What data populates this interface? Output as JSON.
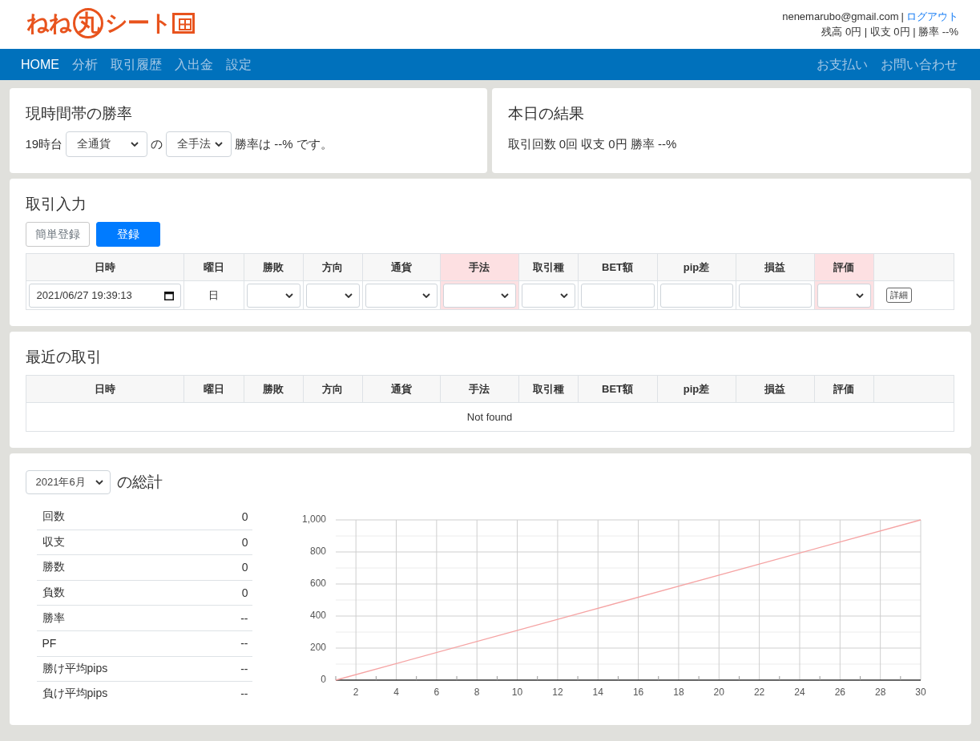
{
  "header": {
    "logo": [
      {
        "text": "ねね",
        "circled": false
      },
      {
        "text": "丸",
        "circled": true
      },
      {
        "text": "シート",
        "circled": false
      }
    ],
    "email": "nenemarubo@gmail.com",
    "separator": "|",
    "logout": "ログアウト",
    "summary": "残高 0円 | 収支 0円 | 勝率 --%"
  },
  "nav": {
    "left": [
      {
        "label": "HOME",
        "selected": true
      },
      {
        "label": "分析",
        "selected": false
      },
      {
        "label": "取引履歴",
        "selected": false
      },
      {
        "label": "入出金",
        "selected": false
      },
      {
        "label": "設定",
        "selected": false
      }
    ],
    "right": [
      {
        "label": "お支払い",
        "selected": false
      },
      {
        "label": "お問い合わせ",
        "selected": false
      }
    ]
  },
  "hour_win_rate": {
    "title": "現時間帯の勝率",
    "hour": "19時台",
    "currency": "全通貨",
    "particle": "の",
    "method": "全手法",
    "result": "勝率は --% です。"
  },
  "today_result": {
    "title": "本日の結果",
    "text": "取引回数 0回 収支 0円 勝率 --%"
  },
  "trade_input": {
    "title": "取引入力",
    "buttons": [
      {
        "label": "簡単登録",
        "kind": "secondary"
      },
      {
        "label": "登録",
        "kind": "primary"
      }
    ],
    "columns": [
      {
        "label": "日時",
        "highlighted": false
      },
      {
        "label": "曜日",
        "highlighted": false
      },
      {
        "label": "勝敗",
        "highlighted": false
      },
      {
        "label": "方向",
        "highlighted": false
      },
      {
        "label": "通貨",
        "highlighted": false
      },
      {
        "label": "手法",
        "highlighted": true
      },
      {
        "label": "取引種",
        "highlighted": false
      },
      {
        "label": "BET額",
        "highlighted": false
      },
      {
        "label": "pip差",
        "highlighted": false
      },
      {
        "label": "損益",
        "highlighted": false
      },
      {
        "label": "評価",
        "highlighted": true
      }
    ],
    "row": [
      {
        "kind": "date",
        "value": "2021/06/27 19:39:13"
      },
      {
        "kind": "text",
        "value": "日"
      },
      {
        "kind": "select"
      },
      {
        "kind": "select"
      },
      {
        "kind": "select"
      },
      {
        "kind": "select"
      },
      {
        "kind": "select"
      },
      {
        "kind": "input"
      },
      {
        "kind": "input"
      },
      {
        "kind": "input"
      },
      {
        "kind": "select"
      },
      {
        "kind": "button",
        "label": "詳細"
      }
    ]
  },
  "recent_trades": {
    "title": "最近の取引",
    "columns": [
      "日時",
      "曜日",
      "勝敗",
      "方向",
      "通貨",
      "手法",
      "取引種",
      "BET額",
      "pip差",
      "損益",
      "評価"
    ],
    "empty_message": "Not found"
  },
  "summary": {
    "month": "2021年6月",
    "title": "の総計",
    "stats": [
      {
        "label": "回数",
        "value": "0"
      },
      {
        "label": "収支",
        "value": "0"
      },
      {
        "label": "勝数",
        "value": "0"
      },
      {
        "label": "負数",
        "value": "0"
      },
      {
        "label": "勝率",
        "value": "--"
      },
      {
        "label": "PF",
        "value": "--"
      },
      {
        "label": "勝け平均pips",
        "value": "--"
      },
      {
        "label": "負け平均pips",
        "value": "--"
      }
    ],
    "chart_data": {
      "type": "line",
      "x": [
        1,
        30
      ],
      "series": [
        {
          "color": "#f5a3a3",
          "values": [
            0,
            1000
          ]
        }
      ],
      "xlim": [
        1,
        30
      ],
      "ylim": [
        0,
        1000
      ],
      "xticks": [
        2,
        4,
        6,
        8,
        10,
        12,
        14,
        16,
        18,
        20,
        22,
        24,
        26,
        28,
        30
      ],
      "yticks": [
        0,
        200,
        400,
        600,
        800,
        {
          "value": 1000,
          "label": "1,000"
        }
      ],
      "grid": true
    }
  }
}
